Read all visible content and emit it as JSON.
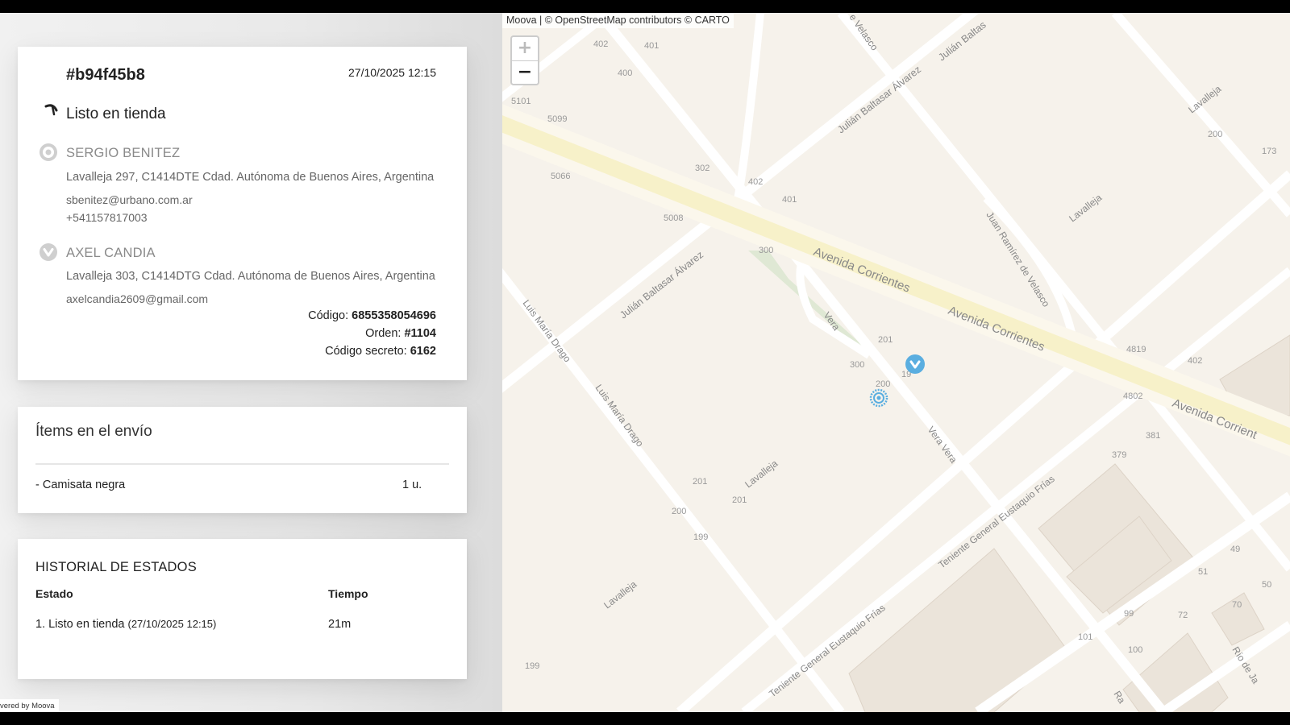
{
  "order": {
    "id": "#b94f45b8",
    "date": "27/10/2025 12:15",
    "status": "Listo en tienda"
  },
  "sender": {
    "name": "SERGIO BENITEZ",
    "address": "Lavalleja 297, C1414DTE Cdad. Autónoma de Buenos Aires, Argentina",
    "email": "sbenitez@urbano.com.ar",
    "phone": "+541157817003"
  },
  "recipient": {
    "name": "AXEL CANDIA",
    "address": "Lavalleja 303, C1414DTG Cdad. Autónoma de Buenos Aires, Argentina",
    "email": "axelcandia2609@gmail.com"
  },
  "codes": {
    "codigo_label": "Código:",
    "codigo_value": "6855358054696",
    "orden_label": "Orden:",
    "orden_value": "#1104",
    "secreto_label": "Código secreto:",
    "secreto_value": "6162"
  },
  "items": {
    "title": "Ítems en el envío",
    "list": [
      {
        "name": "- Camisata negra",
        "qty": "1 u."
      }
    ]
  },
  "history": {
    "title": "HISTORIAL DE ESTADOS",
    "col_state": "Estado",
    "col_time": "Tiempo",
    "rows": [
      {
        "state": "1. Listo en tienda",
        "date": "(27/10/2025 12:15)",
        "time": "21m"
      }
    ]
  },
  "footer": {
    "powered": "vered by Moova"
  },
  "map": {
    "attribution": "Moova | © OpenStreetMap contributors © CARTO",
    "zoom_in": "+",
    "zoom_out": "−",
    "streets": {
      "corrientes": "Avenida Corrientes",
      "corrientes2": "Avenida Corrientes",
      "corrientes3": "Avenida Corrient",
      "julian1": "Julián Baltasar Álvarez",
      "julian2": "Julián Baltasar Álvarez",
      "julian3": "Julián Baltas",
      "velasco_top": "e Velasco",
      "juan_ramirez": "Juan Ramírez de Velasco",
      "lavalleja1": "Lavalleja",
      "lavalleja2": "Lavalleja",
      "lavalleja3": "Lavalleja",
      "lavalleja4": "Lavalleja",
      "luis1": "Luis María Drago",
      "luis2": "Luis María Drago",
      "vera1": "Vera",
      "vera2": "Vera Vera",
      "teniente1": "Teniente General Eustaquio Frías",
      "teniente2": "Teniente General Eustaquio Frías",
      "rio": "Río de Ja",
      "ra": "Ra"
    },
    "numbers": {
      "n402a": "402",
      "n401a": "401",
      "n400": "400",
      "n5101": "5101",
      "n5099": "5099",
      "n5066": "5066",
      "n302": "302",
      "n402b": "402",
      "n401b": "401",
      "n5008": "5008",
      "n300a": "300",
      "n200a": "200",
      "n173": "173",
      "n201a": "201",
      "n300b": "300",
      "n200b": "200",
      "n19x": "19",
      "n4819": "4819",
      "n402c": "402",
      "n4802": "4802",
      "n381": "381",
      "n379": "379",
      "n201b": "201",
      "n201c": "201",
      "n200c": "200",
      "n199a": "199",
      "n49": "49",
      "n51": "51",
      "n50": "50",
      "n70": "70",
      "n72": "72",
      "n99": "99",
      "n101": "101",
      "n100": "100",
      "n199b": "199"
    }
  }
}
